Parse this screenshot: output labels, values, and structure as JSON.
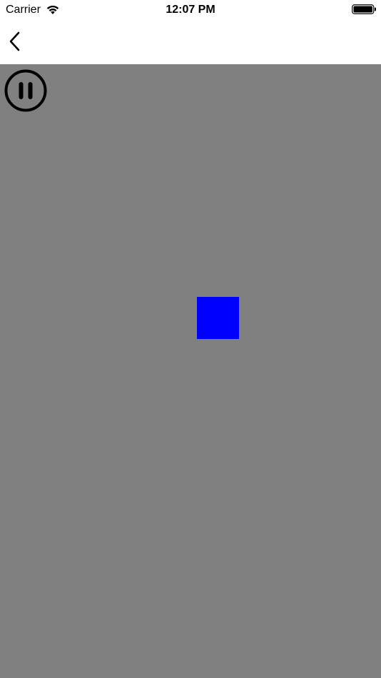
{
  "status_bar": {
    "carrier": "Carrier",
    "time": "12:07 PM",
    "wifi_icon": "wifi-icon",
    "battery_icon": "battery-icon"
  },
  "nav_bar": {
    "back_icon": "chevron-left-icon"
  },
  "game": {
    "background_color": "#808080",
    "pause_icon": "pause-circle-icon",
    "square_color": "#0000ff"
  }
}
